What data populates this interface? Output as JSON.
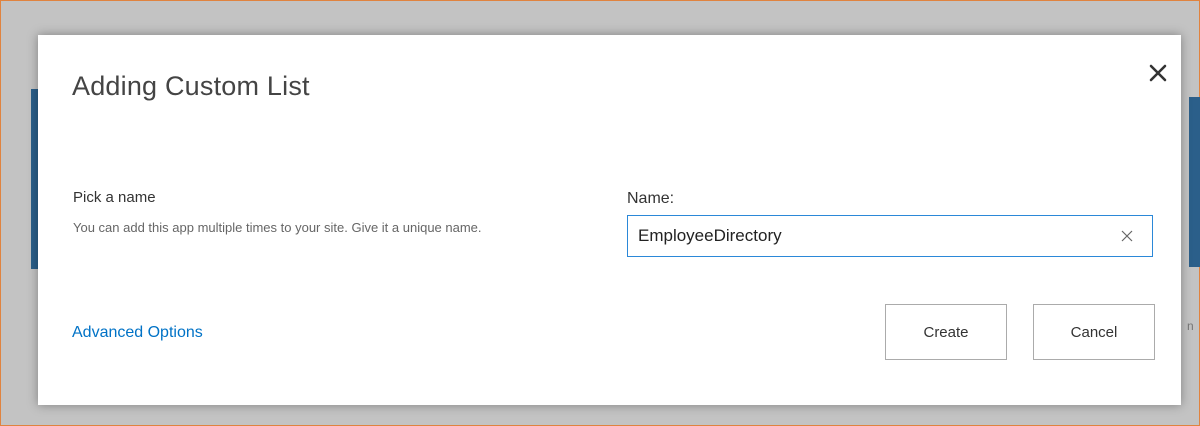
{
  "dialog": {
    "title": "Adding Custom List",
    "close_icon": "close-icon"
  },
  "pick_name": {
    "label": "Pick a name",
    "description": "You can add this app multiple times to your site. Give it a unique name."
  },
  "name_field": {
    "label": "Name:",
    "value": "EmployeeDirectory",
    "clear_icon": "clear-icon"
  },
  "advanced_options": {
    "label": "Advanced Options"
  },
  "buttons": {
    "create": "Create",
    "cancel": "Cancel"
  },
  "colors": {
    "link": "#0072c6",
    "input_border": "#2b88d8",
    "window_border": "#e0833f",
    "backdrop_accent": "#2b5f8a"
  }
}
